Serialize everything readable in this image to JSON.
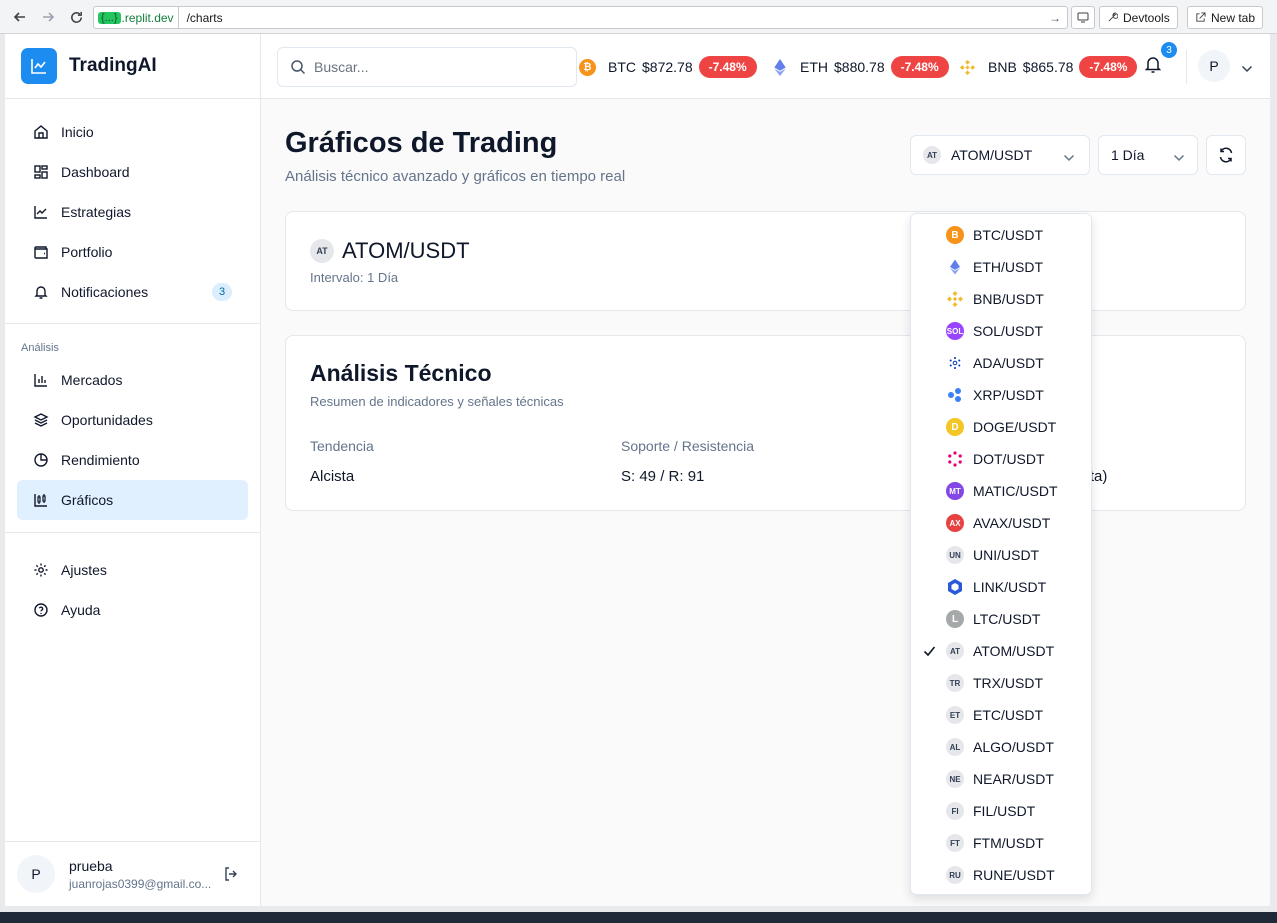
{
  "browser": {
    "host_tag": "{...}",
    "host": ".replit.dev",
    "path": "/charts",
    "devtools_label": "Devtools",
    "newtab_label": "New tab"
  },
  "brand": {
    "name": "TradingAI"
  },
  "sidebar": {
    "items": [
      {
        "label": "Inicio",
        "icon": "home-icon"
      },
      {
        "label": "Dashboard",
        "icon": "dashboard-icon"
      },
      {
        "label": "Estrategias",
        "icon": "chart-line-icon"
      },
      {
        "label": "Portfolio",
        "icon": "wallet-icon"
      },
      {
        "label": "Notificaciones",
        "icon": "bell-icon",
        "badge": "3"
      }
    ],
    "section_label": "Análisis",
    "analysis_items": [
      {
        "label": "Mercados",
        "icon": "bar-chart-icon"
      },
      {
        "label": "Oportunidades",
        "icon": "layers-icon"
      },
      {
        "label": "Rendimiento",
        "icon": "pie-chart-icon"
      },
      {
        "label": "Gráficos",
        "icon": "candles-icon",
        "active": true
      }
    ],
    "bottom_items": [
      {
        "label": "Ajustes",
        "icon": "gear-icon"
      },
      {
        "label": "Ayuda",
        "icon": "help-icon"
      }
    ],
    "user": {
      "initial": "P",
      "name": "prueba",
      "email": "juanrojas0399@gmail.co..."
    }
  },
  "topbar": {
    "search_placeholder": "Buscar...",
    "tickers": [
      {
        "symbol": "BTC",
        "price": "$872.78",
        "change": "-7.48%",
        "color": "#f7931a"
      },
      {
        "symbol": "ETH",
        "price": "$880.78",
        "change": "-7.48%",
        "color": "#627eea"
      },
      {
        "symbol": "BNB",
        "price": "$865.78",
        "change": "-7.48%",
        "color": "#f3ba2f"
      }
    ],
    "notif_count": "3",
    "user_initial": "P"
  },
  "main": {
    "title": "Gráficos de Trading",
    "subtitle": "Análisis técnico avanzado y gráficos en tiempo real",
    "pair_select": {
      "icon_text": "AT",
      "value": "ATOM/USDT"
    },
    "interval_select": {
      "value": "1 Día"
    },
    "pair_card": {
      "icon_text": "AT",
      "pair": "ATOM/USDT",
      "interval": "Intervalo: 1 Día"
    },
    "analysis": {
      "title": "Análisis Técnico",
      "subtitle": "Resumen de indicadores y señales técnicas",
      "stats": [
        {
          "label": "Tendencia",
          "value": "Alcista"
        },
        {
          "label": "Soporte / Resistencia",
          "value": "S: 49 / R: 91"
        },
        {
          "label": "",
          "value": "ista)"
        }
      ]
    }
  },
  "dropdown": {
    "selected": "ATOM/USDT",
    "options": [
      {
        "label": "BTC/USDT",
        "icon": "B",
        "color": "#f7931a"
      },
      {
        "label": "ETH/USDT",
        "icon": "eth",
        "color": "#627eea"
      },
      {
        "label": "BNB/USDT",
        "icon": "bnb",
        "color": "#f3ba2f"
      },
      {
        "label": "SOL/USDT",
        "icon": "SOL",
        "color": "#9945ff"
      },
      {
        "label": "ADA/USDT",
        "icon": "ada",
        "color": "#0033ad"
      },
      {
        "label": "XRP/USDT",
        "icon": "xrp",
        "color": "#3b82f6"
      },
      {
        "label": "DOGE/USDT",
        "icon": "D",
        "color": "#f3c623"
      },
      {
        "label": "DOT/USDT",
        "icon": "dot",
        "color": "#e6007a"
      },
      {
        "label": "MATIC/USDT",
        "icon": "MT",
        "color": "#8247e5"
      },
      {
        "label": "AVAX/USDT",
        "icon": "AX",
        "color": "#e84142"
      },
      {
        "label": "UNI/USDT",
        "icon": "UN",
        "color": ""
      },
      {
        "label": "LINK/USDT",
        "icon": "link",
        "color": "#2a5ada"
      },
      {
        "label": "LTC/USDT",
        "icon": "L",
        "color": "#a6a9aa"
      },
      {
        "label": "ATOM/USDT",
        "icon": "AT",
        "color": ""
      },
      {
        "label": "TRX/USDT",
        "icon": "TR",
        "color": ""
      },
      {
        "label": "ETC/USDT",
        "icon": "ET",
        "color": ""
      },
      {
        "label": "ALGO/USDT",
        "icon": "AL",
        "color": ""
      },
      {
        "label": "NEAR/USDT",
        "icon": "NE",
        "color": ""
      },
      {
        "label": "FIL/USDT",
        "icon": "FI",
        "color": ""
      },
      {
        "label": "FTM/USDT",
        "icon": "FT",
        "color": ""
      },
      {
        "label": "RUNE/USDT",
        "icon": "RU",
        "color": ""
      }
    ]
  }
}
